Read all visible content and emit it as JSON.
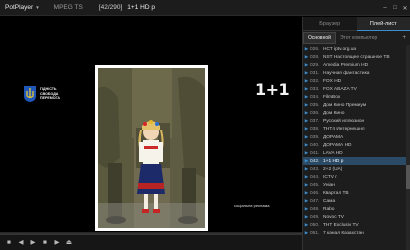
{
  "titlebar": {
    "app_label": "PotPlayer",
    "format": "MPEG TS",
    "position": "[42/290]",
    "title": "1+1 HD p"
  },
  "window_controls": [
    "–",
    "□",
    "✕"
  ],
  "video": {
    "channel_logo_text": [
      "ГІДНІСТЬ",
      "СВОБОДА",
      "ПЕРЕМОГА"
    ],
    "brand": "1+1",
    "caption": "соціальна реклама"
  },
  "panel": {
    "tabs": [
      {
        "label": "Браузер",
        "active": false
      },
      {
        "label": "Плей-лист",
        "active": true
      }
    ],
    "subtabs": [
      {
        "label": "Основной",
        "active": true
      },
      {
        "label": "Этот компьютер",
        "active": false
      }
    ],
    "add_label": "+",
    "items": [
      {
        "num": "026.",
        "name": "НСТ iptv.org.ua"
      },
      {
        "num": "028.",
        "name": "NST Настоящее страшное ТВ"
      },
      {
        "num": "029.",
        "name": "Amedia Premium HD"
      },
      {
        "num": "031.",
        "name": "Научная фантастика"
      },
      {
        "num": "032.",
        "name": "FOX HD"
      },
      {
        "num": "033.",
        "name": "FOX ABAZA TV"
      },
      {
        "num": "034.",
        "name": "FilmBox"
      },
      {
        "num": "035.",
        "name": "Дом Кино Премиум"
      },
      {
        "num": "036.",
        "name": "Дом Кино"
      },
      {
        "num": "037.",
        "name": "Русский иллюзион"
      },
      {
        "num": "038.",
        "name": "ТНТ4 Интернешнл"
      },
      {
        "num": "039.",
        "name": "ДОРАМА"
      },
      {
        "num": "040.",
        "name": "ДОРАМА HD"
      },
      {
        "num": "041.",
        "name": "LAVA HD"
      },
      {
        "num": "042.",
        "name": "1+1 HD p",
        "selected": true
      },
      {
        "num": "043.",
        "name": "2+2 (UA)"
      },
      {
        "num": "044.",
        "name": "ICTV r"
      },
      {
        "num": "045.",
        "name": "Унiан"
      },
      {
        "num": "046.",
        "name": "Квартал ТВ"
      },
      {
        "num": "047.",
        "name": "Сама"
      },
      {
        "num": "048.",
        "name": "Rabo"
      },
      {
        "num": "049.",
        "name": "Novoc TV"
      },
      {
        "num": "050.",
        "name": "ТНТ Exclusiv TV"
      },
      {
        "num": "051.",
        "name": "7 канал Казахстан"
      }
    ]
  },
  "controls": {
    "buttons": [
      "■",
      "◀",
      "▶",
      "■",
      "▶",
      "⏏"
    ]
  },
  "colors": {
    "accent": "#3b8fd0",
    "selected_row": "#2b4a66"
  }
}
